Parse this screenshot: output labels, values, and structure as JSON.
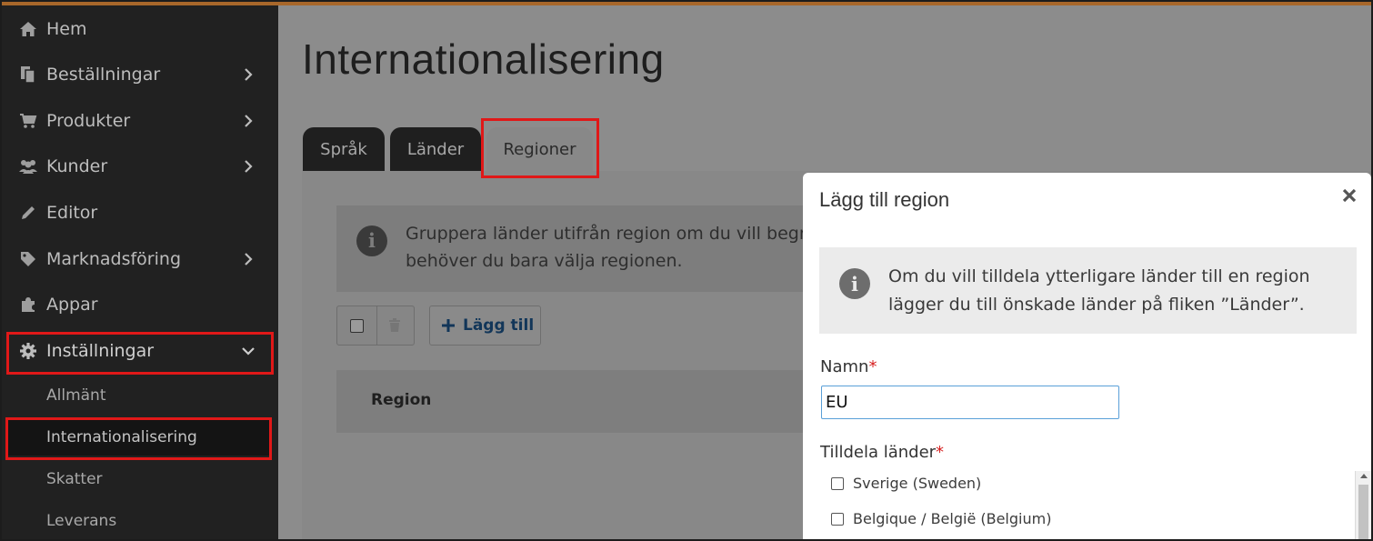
{
  "sidebar": {
    "items": [
      {
        "label": "Hem",
        "icon": "home-icon"
      },
      {
        "label": "Beställningar",
        "icon": "orders-icon"
      },
      {
        "label": "Produkter",
        "icon": "cart-icon"
      },
      {
        "label": "Kunder",
        "icon": "users-icon"
      },
      {
        "label": "Editor",
        "icon": "pencil-icon"
      },
      {
        "label": "Marknadsföring",
        "icon": "tag-icon"
      },
      {
        "label": "Appar",
        "icon": "puzzle-icon"
      },
      {
        "label": "Inställningar",
        "icon": "gear-icon"
      }
    ],
    "subitems": [
      {
        "label": "Allmänt"
      },
      {
        "label": "Internationalisering"
      },
      {
        "label": "Skatter"
      },
      {
        "label": "Leverans"
      }
    ]
  },
  "page": {
    "title": "Internationalisering",
    "tabs": [
      {
        "label": "Språk"
      },
      {
        "label": "Länder"
      },
      {
        "label": "Regioner"
      }
    ],
    "info_text_line1": "Gruppera länder utifrån region om du vill begrä",
    "info_text_line2": "behöver du bara välja regionen.",
    "add_button": "Lägg till",
    "table_header_region": "Region"
  },
  "modal": {
    "title": "Lägg till region",
    "info_line1": "Om du vill tilldela ytterligare länder till en region",
    "info_line2": "lägger du till önskade länder på fliken ”Länder”.",
    "name_label": "Namn",
    "name_value": "EU",
    "countries_label": "Tilldela länder",
    "required_mark": "*",
    "countries": [
      {
        "label": "Sverige (Sweden)"
      },
      {
        "label": "Belgique / België (Belgium)"
      }
    ]
  },
  "colors": {
    "sidebar_bg": "#212121",
    "highlight_red": "#e01818",
    "accent_blue": "#123659",
    "overlay": "#8c8c8c"
  }
}
